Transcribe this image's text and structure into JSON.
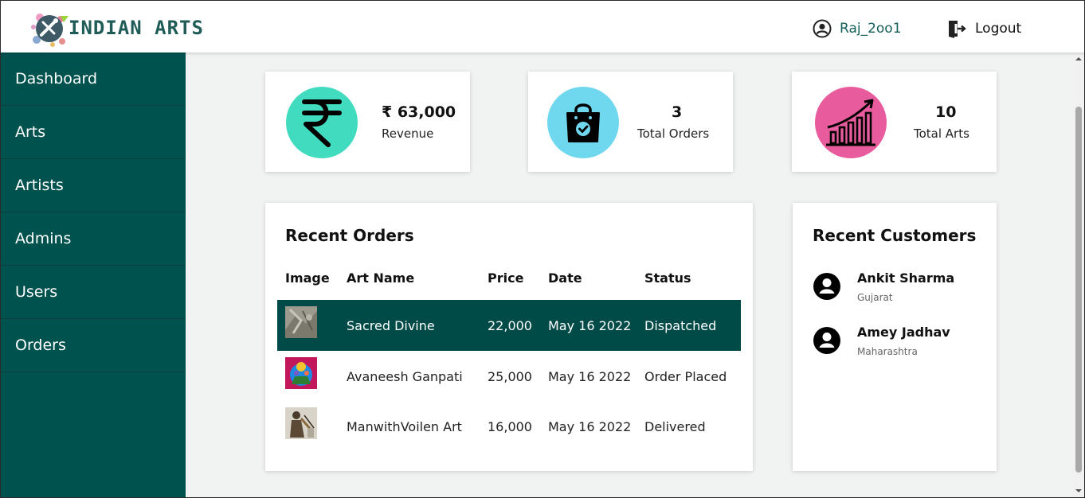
{
  "header": {
    "logo_text": "INDIAN ARTS",
    "username": "Raj_2oo1",
    "logout_label": "Logout"
  },
  "sidebar": {
    "items": [
      {
        "label": "Dashboard"
      },
      {
        "label": "Arts"
      },
      {
        "label": "Artists"
      },
      {
        "label": "Admins"
      },
      {
        "label": "Users"
      },
      {
        "label": "Orders"
      }
    ]
  },
  "stats": [
    {
      "value": "₹ 63,000",
      "label": "Revenue",
      "icon": "rupee-icon",
      "color": "#41dcbf"
    },
    {
      "value": "3",
      "label": "Total Orders",
      "icon": "shopping-bag-check-icon",
      "color": "#6fd7ee"
    },
    {
      "value": "10",
      "label": "Total Arts",
      "icon": "growth-chart-icon",
      "color": "#e85b9d"
    }
  ],
  "orders": {
    "title": "Recent Orders",
    "columns": [
      "Image",
      "Art Name",
      "Price",
      "Date",
      "Status"
    ],
    "rows": [
      {
        "art_name": "Sacred Divine",
        "price": "22,000",
        "date": "May 16 2022",
        "status": "Dispatched"
      },
      {
        "art_name": "Avaneesh Ganpati",
        "price": "25,000",
        "date": "May 16 2022",
        "status": "Order Placed"
      },
      {
        "art_name": "ManwithVoilen Art",
        "price": "16,000",
        "date": "May 16 2022",
        "status": "Delivered"
      }
    ]
  },
  "customers": {
    "title": "Recent Customers",
    "items": [
      {
        "name": "Ankit Sharma",
        "place": "Gujarat"
      },
      {
        "name": "Amey Jadhav",
        "place": "Maharashtra"
      }
    ]
  },
  "colors": {
    "sidebar": "#00524f",
    "active_row": "#004a48",
    "brand_text": "#1f5c57"
  }
}
